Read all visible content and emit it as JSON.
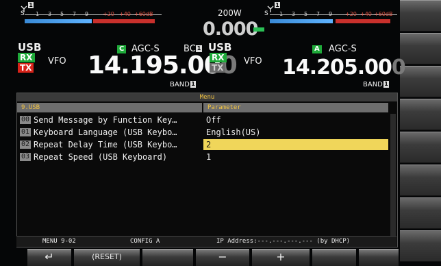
{
  "left_vfo": {
    "s_label": "S",
    "ticks": [
      "1",
      "3",
      "5",
      "7",
      "9",
      "+20",
      "+40",
      "+60dB"
    ],
    "mode": "USB",
    "agc_letter": "C",
    "agc": "AGC-S",
    "bc": "BC",
    "rx": "RX",
    "tx": "TX",
    "vfo": "VFO",
    "frequency": "14.195.00",
    "frequency_dim": "0",
    "band": "BAND"
  },
  "power": {
    "value": "200W",
    "reading": "0.000"
  },
  "right_vfo": {
    "s_label": "S",
    "ticks": [
      "1",
      "3",
      "5",
      "7",
      "9",
      "+20",
      "+40",
      "+60dB"
    ],
    "mode": "USB",
    "agc_letter": "A",
    "agc": "AGC-S",
    "rx": "RX",
    "tx": "TX",
    "vfo": "VFO",
    "frequency": "14.205.00",
    "frequency_dim": "0",
    "band": "BAND"
  },
  "menu": {
    "title": "Menu",
    "header_left": "9.USB",
    "header_right": "Parameter",
    "rows": [
      {
        "num": "00",
        "item": "Send Message by Function Key…",
        "param": "Off"
      },
      {
        "num": "01",
        "item": "Keyboard Language (USB Keybo…",
        "param": "English(US)"
      },
      {
        "num": "02",
        "item": "Repeat Delay Time (USB Keybo…",
        "param": "2"
      },
      {
        "num": "03",
        "item": "Repeat Speed (USB Keyboard)",
        "param": "1"
      }
    ]
  },
  "status": {
    "menu_id": "MENU 9-02",
    "config": "CONFIG A",
    "ip": "IP Address:---.---.---.--- (by DHCP)"
  },
  "function_keys": {
    "back": "↵",
    "reset": "(RESET)",
    "minus": "−",
    "plus": "+"
  }
}
